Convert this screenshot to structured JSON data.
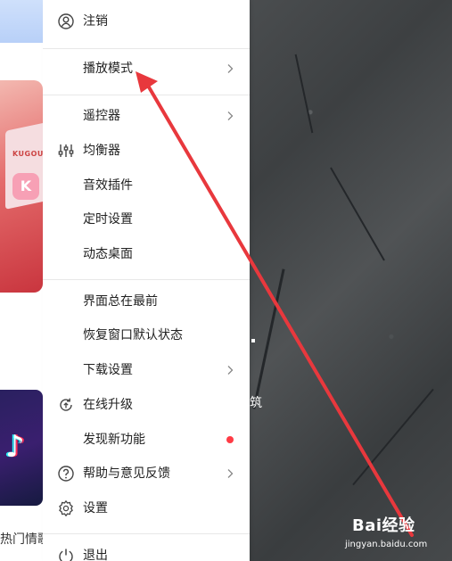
{
  "left_app": {
    "promo_brand": "KUGOU",
    "promo_badge": "K",
    "hot_section_label": "热门情歌"
  },
  "background": {
    "text": "筑"
  },
  "menu": {
    "items": [
      {
        "label": "注销",
        "icon": "user-circle-icon",
        "submenu": false,
        "new_dot": false
      },
      {
        "label": "播放模式",
        "icon": "",
        "submenu": true,
        "new_dot": false
      },
      {
        "label": "遥控器",
        "icon": "",
        "submenu": true,
        "new_dot": false
      },
      {
        "label": "均衡器",
        "icon": "equalizer-icon",
        "submenu": false,
        "new_dot": false
      },
      {
        "label": "音效插件",
        "icon": "",
        "submenu": false,
        "new_dot": false
      },
      {
        "label": "定时设置",
        "icon": "",
        "submenu": false,
        "new_dot": false
      },
      {
        "label": "动态桌面",
        "icon": "",
        "submenu": false,
        "new_dot": false
      },
      {
        "label": "界面总在最前",
        "icon": "",
        "submenu": false,
        "new_dot": false
      },
      {
        "label": "恢复窗口默认状态",
        "icon": "",
        "submenu": false,
        "new_dot": false
      },
      {
        "label": "下载设置",
        "icon": "",
        "submenu": true,
        "new_dot": false
      },
      {
        "label": "在线升级",
        "icon": "refresh-upgrade-icon",
        "submenu": false,
        "new_dot": false
      },
      {
        "label": "发现新功能",
        "icon": "",
        "submenu": false,
        "new_dot": true
      },
      {
        "label": "帮助与意见反馈",
        "icon": "question-circle-icon",
        "submenu": true,
        "new_dot": false
      },
      {
        "label": "设置",
        "icon": "gear-icon",
        "submenu": false,
        "new_dot": false
      },
      {
        "label": "退出",
        "icon": "power-icon",
        "submenu": false,
        "new_dot": false
      }
    ]
  },
  "annotation": {
    "arrow_color": "#e8383d",
    "points_to": "播放模式"
  },
  "watermark": {
    "logo": "Bai经验",
    "url": "jingyan.baidu.com"
  },
  "colors": {
    "accent_red": "#ff3b45",
    "menu_bg": "#ffffff",
    "separator": "#e8e8e8"
  }
}
